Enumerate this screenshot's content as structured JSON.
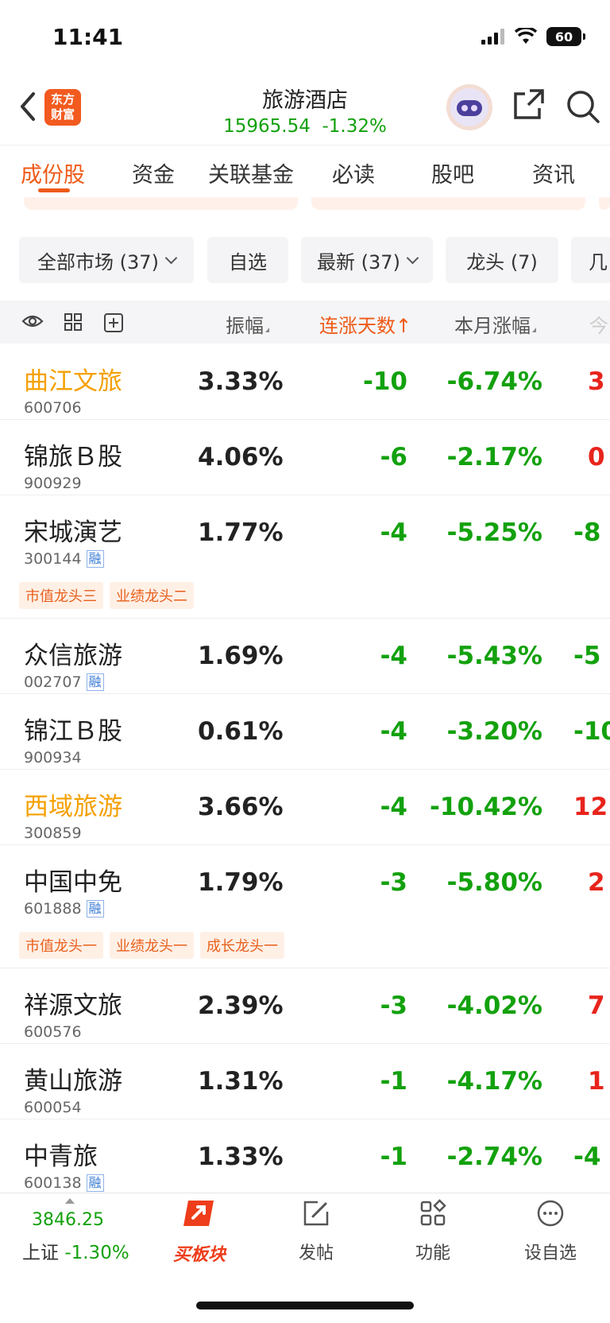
{
  "status": {
    "time": "11:41",
    "battery": "60"
  },
  "header": {
    "logo_line1": "东方",
    "logo_line2": "财富",
    "title": "旅游酒店",
    "index_value": "15965.54",
    "index_change": "-1.32%"
  },
  "tabs": [
    "成份股",
    "资金",
    "关联基金",
    "必读",
    "股吧",
    "资讯"
  ],
  "filters": {
    "market": "全部市场 (37)",
    "watch": "自选",
    "latest": "最新 (37)",
    "leader": "龙头 (7)",
    "more": "几"
  },
  "columns": {
    "amplitude": "振幅",
    "streak": "连涨天数",
    "streak_arrow": "↑",
    "month": "本月涨幅",
    "today": "今"
  },
  "stocks": [
    {
      "name": "曲江文旅",
      "code": "600706",
      "amp": "3.33%",
      "days": "-10",
      "month": "-6.74%",
      "clip": "3"
    },
    {
      "name": "锦旅Ｂ股",
      "code": "900929",
      "amp": "4.06%",
      "days": "-6",
      "month": "-2.17%",
      "clip": "0"
    },
    {
      "name": "宋城演艺",
      "code": "300144",
      "rong": "融",
      "amp": "1.77%",
      "days": "-4",
      "month": "-5.25%",
      "clip": "-8",
      "tags": [
        "市值龙头三",
        "业绩龙头二"
      ]
    },
    {
      "name": "众信旅游",
      "code": "002707",
      "rong": "融",
      "amp": "1.69%",
      "days": "-4",
      "month": "-5.43%",
      "clip": "-5"
    },
    {
      "name": "锦江Ｂ股",
      "code": "900934",
      "amp": "0.61%",
      "days": "-4",
      "month": "-3.20%",
      "clip": "-10"
    },
    {
      "name": "西域旅游",
      "code": "300859",
      "amp": "3.66%",
      "days": "-4",
      "month": "-10.42%",
      "clip": "12"
    },
    {
      "name": "中国中免",
      "code": "601888",
      "rong": "融",
      "amp": "1.79%",
      "days": "-3",
      "month": "-5.80%",
      "clip": "2",
      "tags": [
        "市值龙头一",
        "业绩龙头一",
        "成长龙头一"
      ]
    },
    {
      "name": "祥源文旅",
      "code": "600576",
      "amp": "2.39%",
      "days": "-3",
      "month": "-4.02%",
      "clip": "7"
    },
    {
      "name": "黄山旅游",
      "code": "600054",
      "amp": "1.31%",
      "days": "-1",
      "month": "-4.17%",
      "clip": "1"
    },
    {
      "name": "中青旅",
      "code": "600138",
      "rong": "融",
      "amp": "1.33%",
      "days": "-1",
      "month": "-2.74%",
      "clip": "-4"
    }
  ],
  "bottom": {
    "index_value": "3846.25",
    "index_name": "上证",
    "index_change": "-1.30%",
    "nav": [
      "买板块",
      "发帖",
      "功能",
      "设自选"
    ]
  },
  "colors": {
    "accent": "#ee5a17",
    "down": "#13a10e",
    "up": "#e8241c",
    "highlight": "#f5a000"
  }
}
